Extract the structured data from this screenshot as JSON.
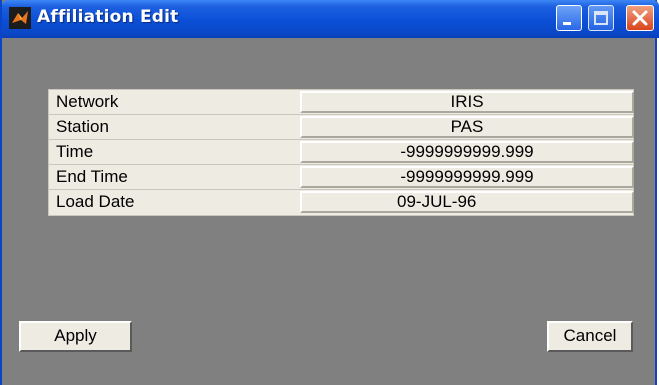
{
  "window": {
    "title": "Affiliation Edit",
    "app_icon": "matlab-icon",
    "controls": [
      "minimize-icon",
      "maximize-icon",
      "close-icon"
    ]
  },
  "fields": [
    {
      "label": "Network",
      "value": "IRIS"
    },
    {
      "label": "Station",
      "value": "PAS"
    },
    {
      "label": "Time",
      "value": "-9999999999.999"
    },
    {
      "label": "End Time",
      "value": "-9999999999.999"
    },
    {
      "label": "Load Date",
      "value": "09-JUL-96"
    }
  ],
  "buttons": {
    "apply": "Apply",
    "cancel": "Cancel"
  },
  "colors": {
    "titlebar": "#0a4fd6",
    "window_bg": "#808080",
    "panel_bg": "#eeebe2",
    "close_button": "#d8441e"
  }
}
